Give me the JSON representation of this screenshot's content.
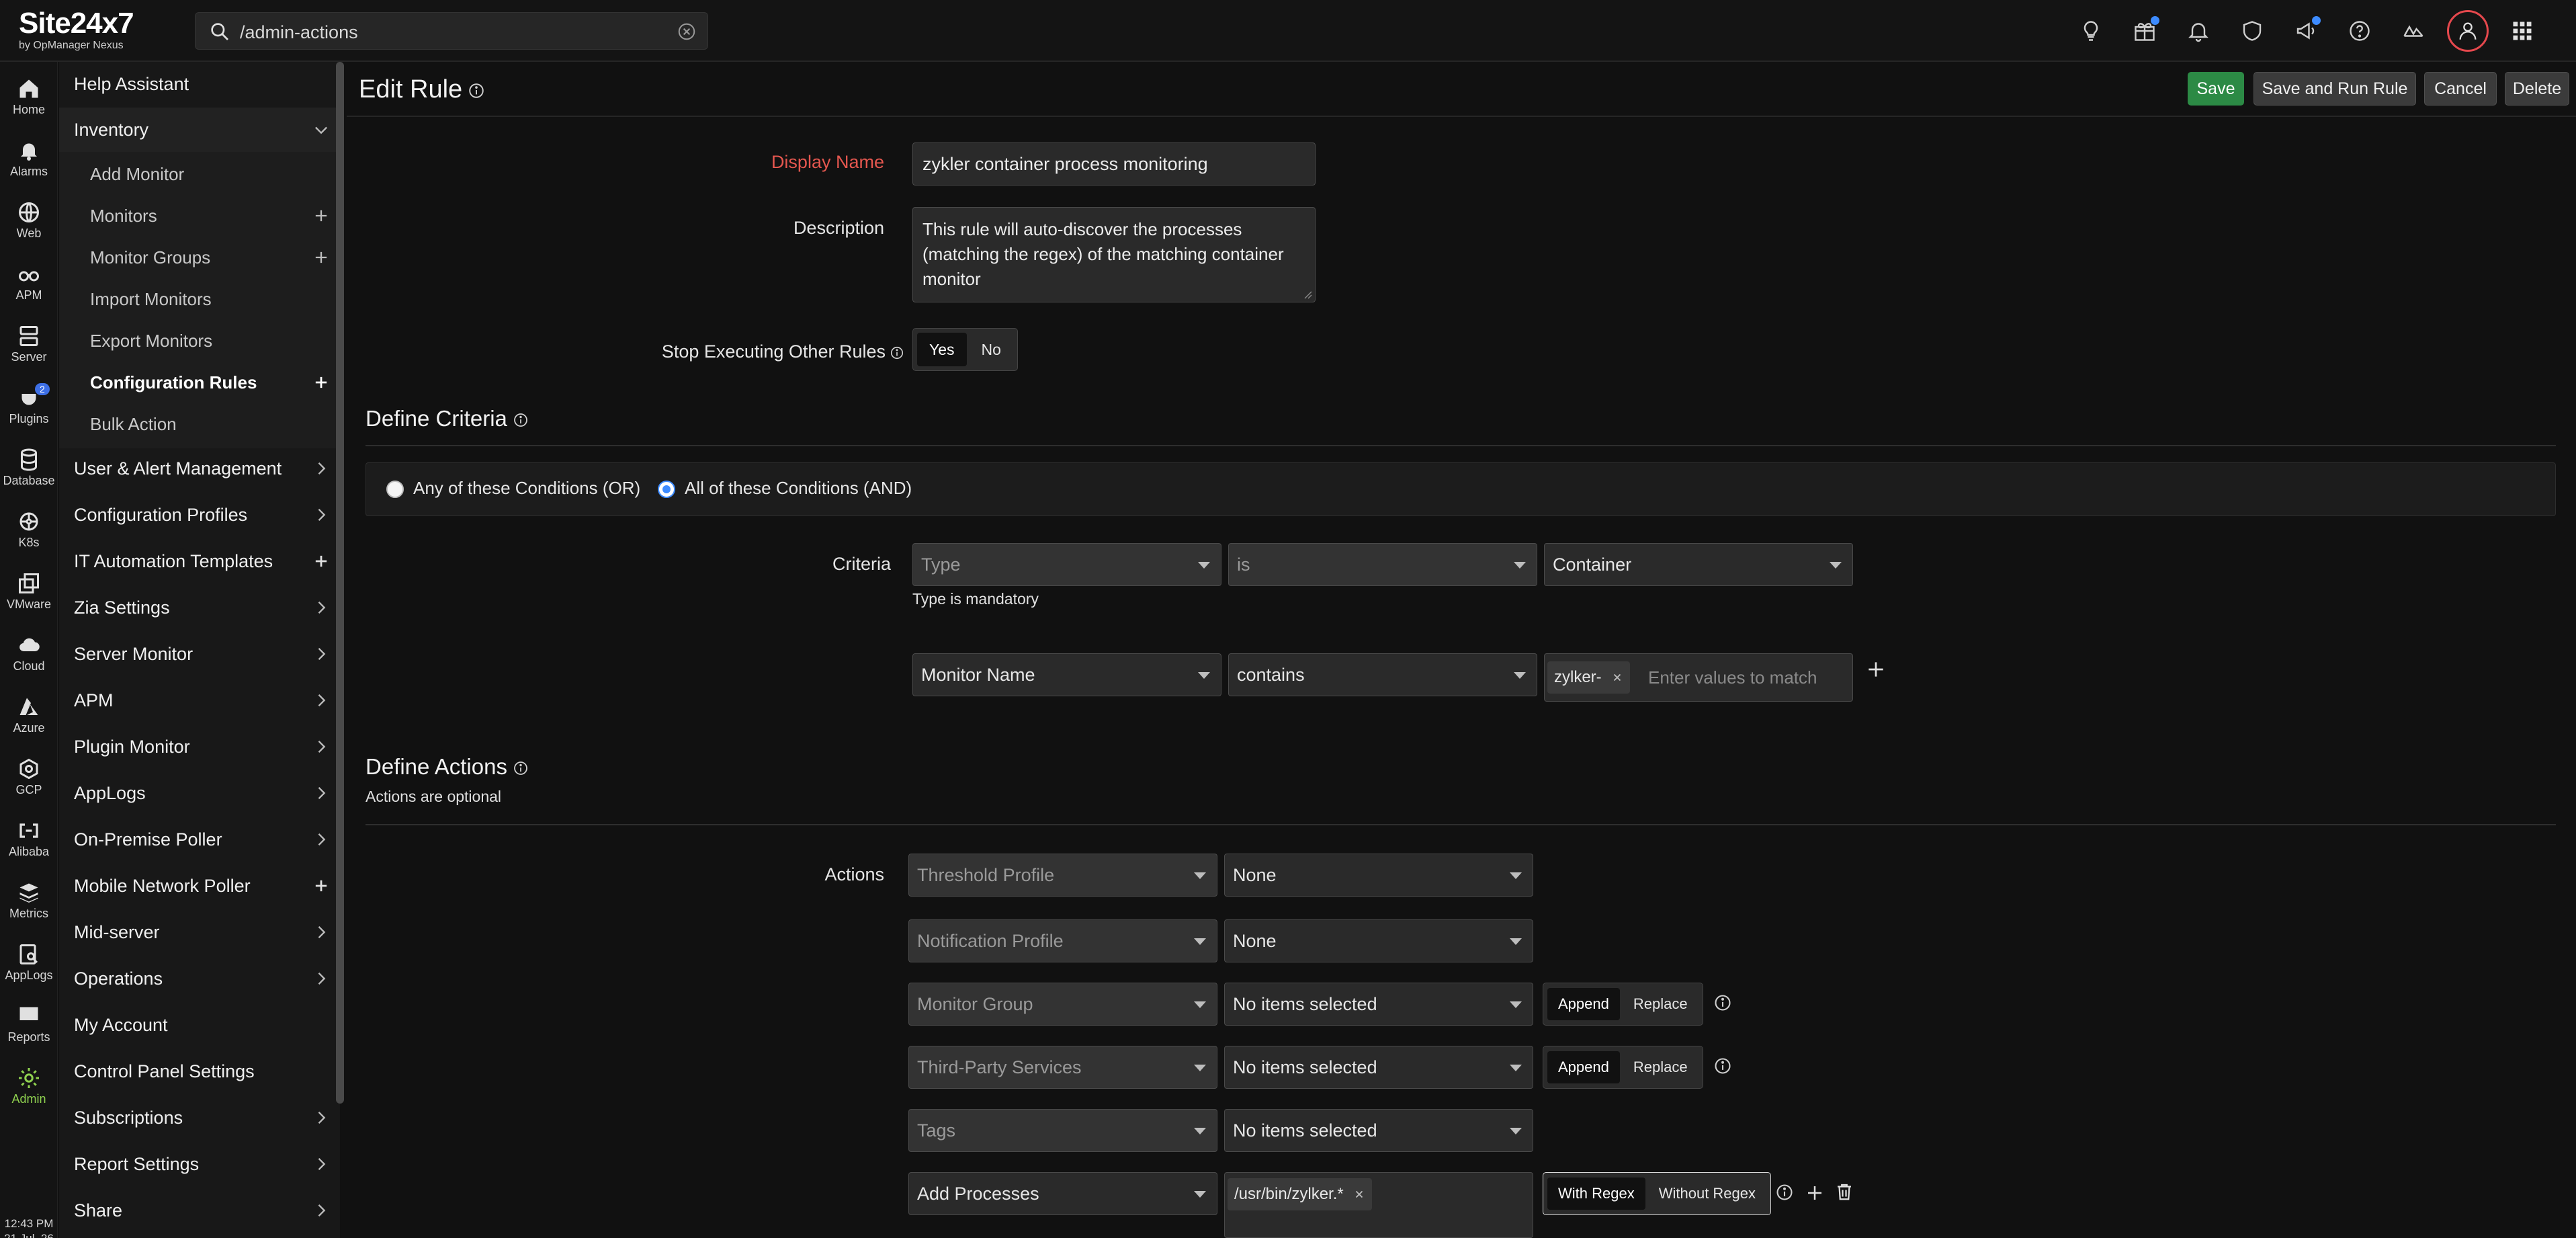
{
  "brand": {
    "name_main": "Site24x7",
    "name_sub": "by OpManager Nexus"
  },
  "search": {
    "value": "/admin-actions"
  },
  "rail": {
    "items": [
      {
        "label": "Home",
        "icon": "home-icon"
      },
      {
        "label": "Alarms",
        "icon": "bell-icon"
      },
      {
        "label": "Web",
        "icon": "globe-icon"
      },
      {
        "label": "APM",
        "icon": "binoculars-icon"
      },
      {
        "label": "Server",
        "icon": "server-icon"
      },
      {
        "label": "Plugins",
        "icon": "plug-icon",
        "badge": "2"
      },
      {
        "label": "Database",
        "icon": "database-icon"
      },
      {
        "label": "K8s",
        "icon": "k8s-icon"
      },
      {
        "label": "VMware",
        "icon": "vmware-icon"
      },
      {
        "label": "Cloud",
        "icon": "cloud-icon"
      },
      {
        "label": "Azure",
        "icon": "azure-icon"
      },
      {
        "label": "GCP",
        "icon": "gcp-icon"
      },
      {
        "label": "Alibaba",
        "icon": "alibaba-icon"
      },
      {
        "label": "Metrics",
        "icon": "layers-icon"
      },
      {
        "label": "AppLogs",
        "icon": "applogs-icon"
      },
      {
        "label": "Reports",
        "icon": "reports-icon"
      },
      {
        "label": "Admin",
        "icon": "gear-icon"
      }
    ],
    "time": "12:43 PM",
    "date": "21 Jul, 26"
  },
  "menu": {
    "help": "Help Assistant",
    "inventory": "Inventory",
    "inventory_items": [
      "Add Monitor",
      "Monitors",
      "Monitor Groups",
      "Import Monitors",
      "Export Monitors",
      "Configuration Rules",
      "Bulk Action"
    ],
    "sections": [
      "User & Alert Management",
      "Configuration Profiles",
      "IT Automation Templates",
      "Zia Settings",
      "Server Monitor",
      "APM",
      "Plugin Monitor",
      "AppLogs",
      "On-Premise Poller",
      "Mobile Network Poller",
      "Mid-server",
      "Operations",
      "My Account",
      "Control Panel Settings",
      "Subscriptions",
      "Report Settings",
      "Share"
    ]
  },
  "page": {
    "title": "Edit Rule",
    "buttons": {
      "save": "Save",
      "save_run": "Save and Run Rule",
      "cancel": "Cancel",
      "delete": "Delete"
    }
  },
  "form": {
    "display_name_label": "Display Name",
    "display_name_value": "zykler container process monitoring",
    "description_label": "Description",
    "description_value": "This rule will auto-discover the processes (matching the regex) of the matching container monitor",
    "stop_label": "Stop Executing Other Rules",
    "stop_yes": "Yes",
    "stop_no": "No"
  },
  "criteria": {
    "title": "Define Criteria",
    "or_label": "Any of these Conditions (OR)",
    "and_label": "All of these Conditions (AND)",
    "label": "Criteria",
    "row1": {
      "field": "Type",
      "operator": "is",
      "value": "Container",
      "helper": "Type is mandatory"
    },
    "row2": {
      "field": "Monitor Name",
      "operator": "contains",
      "chip": "zylker-",
      "placeholder": "Enter values to match"
    }
  },
  "actions": {
    "title": "Define Actions",
    "subtitle": "Actions are optional",
    "label": "Actions",
    "rows": [
      {
        "field": "Threshold Profile",
        "value": "None"
      },
      {
        "field": "Notification Profile",
        "value": "None"
      },
      {
        "field": "Monitor Group",
        "value": "No items selected",
        "seg": [
          "Append",
          "Replace"
        ]
      },
      {
        "field": "Third-Party Services",
        "value": "No items selected",
        "seg": [
          "Append",
          "Replace"
        ]
      },
      {
        "field": "Tags",
        "value": "No items selected"
      },
      {
        "field": "Add Processes",
        "chip": "/usr/bin/zylker.*",
        "seg": [
          "With Regex",
          "Without Regex"
        ]
      }
    ]
  }
}
